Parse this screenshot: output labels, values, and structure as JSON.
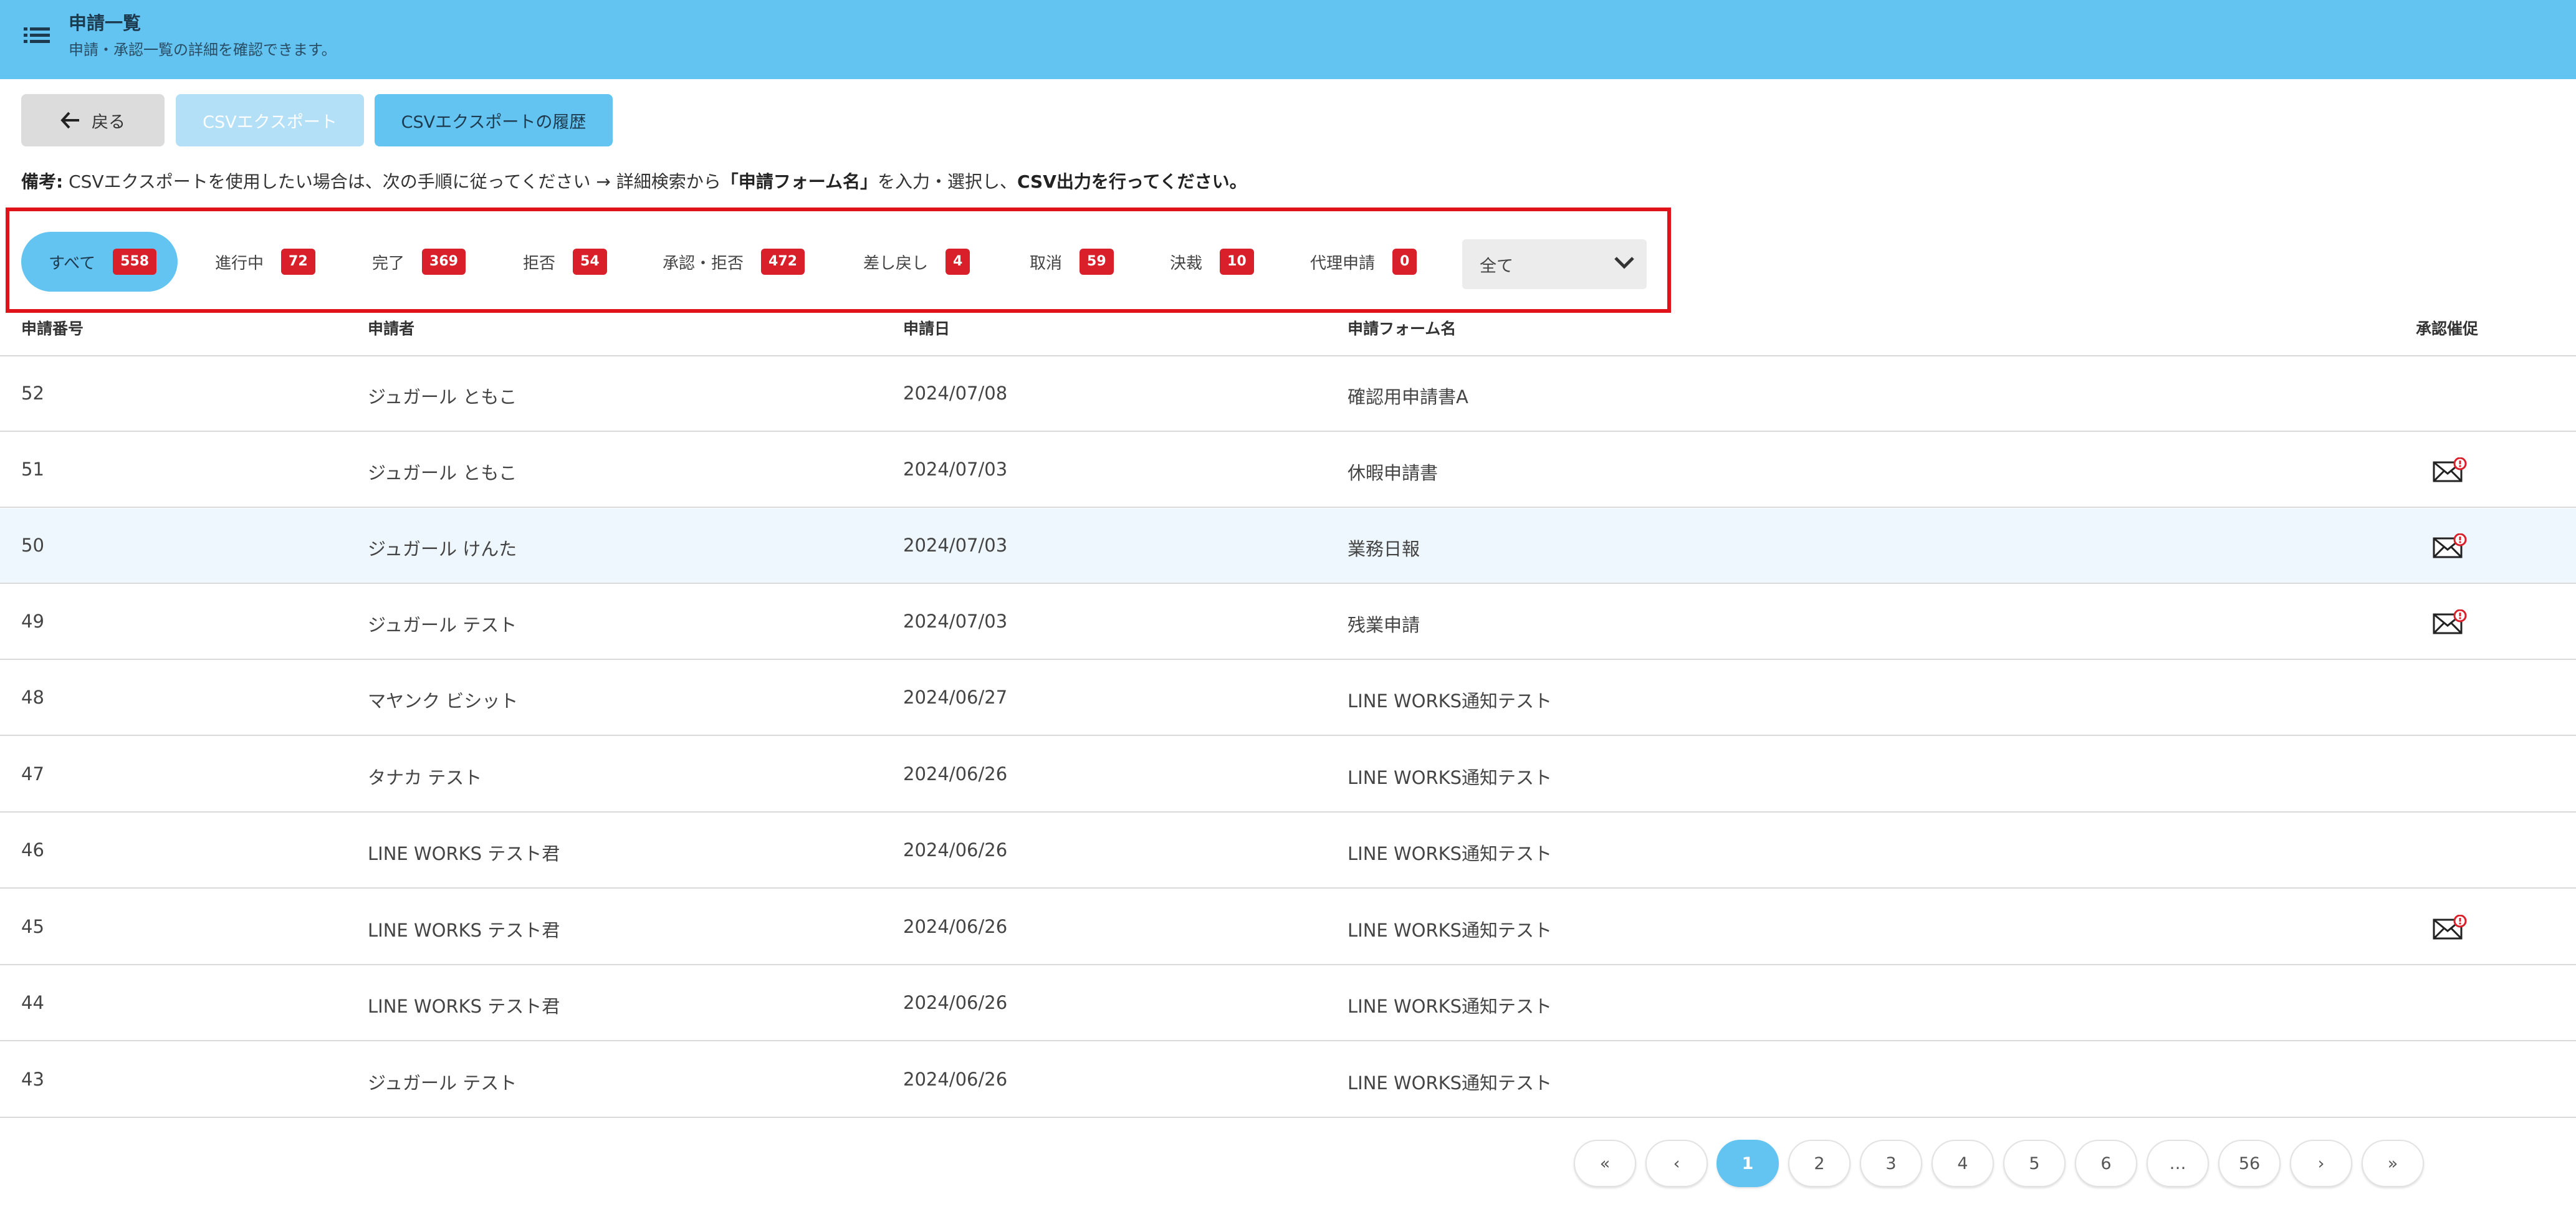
{
  "header": {
    "title": "申請一覧",
    "subtitle": "申請・承認一覧の詳細を確認できます。"
  },
  "toolbar": {
    "back_label": "戻る",
    "export_label": "CSVエクスポート",
    "history_label": "CSVエクスポートの履歴"
  },
  "note": {
    "prefix": "備考:",
    "text1": " CSVエクスポートを使用したい場合は、次の手順に従ってください → 詳細検索から",
    "bold": "「申請フォーム名」",
    "text2": "を入力・選択し、",
    "bold2": "CSV出力を行ってください。"
  },
  "filters": [
    {
      "label": "すべて",
      "count": "558"
    },
    {
      "label": "進行中",
      "count": "72"
    },
    {
      "label": "完了",
      "count": "369"
    },
    {
      "label": "拒否",
      "count": "54"
    },
    {
      "label": "承認・拒否",
      "count": "472"
    },
    {
      "label": "差し戻し",
      "count": "4"
    },
    {
      "label": "取消",
      "count": "59"
    },
    {
      "label": "決裁",
      "count": "10"
    },
    {
      "label": "代理申請",
      "count": "0"
    }
  ],
  "select": {
    "value": "全て"
  },
  "table": {
    "headers": [
      "申請番号",
      "申請者",
      "申請日",
      "申請フォーム名",
      "承認催促"
    ],
    "rows": [
      {
        "id": "52",
        "applicant": "ジュガール ともこ",
        "date": "2024/07/08",
        "form": "確認用申請書A",
        "reminder": false
      },
      {
        "id": "51",
        "applicant": "ジュガール ともこ",
        "date": "2024/07/03",
        "form": "休暇申請書",
        "reminder": true
      },
      {
        "id": "50",
        "applicant": "ジュガール けんた",
        "date": "2024/07/03",
        "form": "業務日報",
        "reminder": true
      },
      {
        "id": "49",
        "applicant": "ジュガール テスト",
        "date": "2024/07/03",
        "form": "残業申請",
        "reminder": true
      },
      {
        "id": "48",
        "applicant": "マヤンク ビシット",
        "date": "2024/06/27",
        "form": "LINE WORKS通知テスト",
        "reminder": false
      },
      {
        "id": "47",
        "applicant": "タナカ テスト",
        "date": "2024/06/26",
        "form": "LINE WORKS通知テスト",
        "reminder": false
      },
      {
        "id": "46",
        "applicant": "LINE WORKS テスト君",
        "date": "2024/06/26",
        "form": "LINE WORKS通知テスト",
        "reminder": false
      },
      {
        "id": "45",
        "applicant": "LINE WORKS テスト君",
        "date": "2024/06/26",
        "form": "LINE WORKS通知テスト",
        "reminder": true
      },
      {
        "id": "44",
        "applicant": "LINE WORKS テスト君",
        "date": "2024/06/26",
        "form": "LINE WORKS通知テスト",
        "reminder": false
      },
      {
        "id": "43",
        "applicant": "ジュガール テスト",
        "date": "2024/06/26",
        "form": "LINE WORKS通知テスト",
        "reminder": false
      }
    ]
  },
  "pagination": {
    "first": "«",
    "prev": "‹",
    "pages": [
      "1",
      "2",
      "3",
      "4",
      "5",
      "6",
      "…",
      "56"
    ],
    "next": "›",
    "last": "»",
    "current": "1"
  },
  "colors": {
    "header": "#63c4f1",
    "badge": "#d9202a",
    "highlight_box": "#e0131a"
  },
  "icons": {
    "menu": "list-menu-icon",
    "back": "arrow-left-icon",
    "select": "chevron-down-icon",
    "reminder": "mail-reminder-icon"
  }
}
